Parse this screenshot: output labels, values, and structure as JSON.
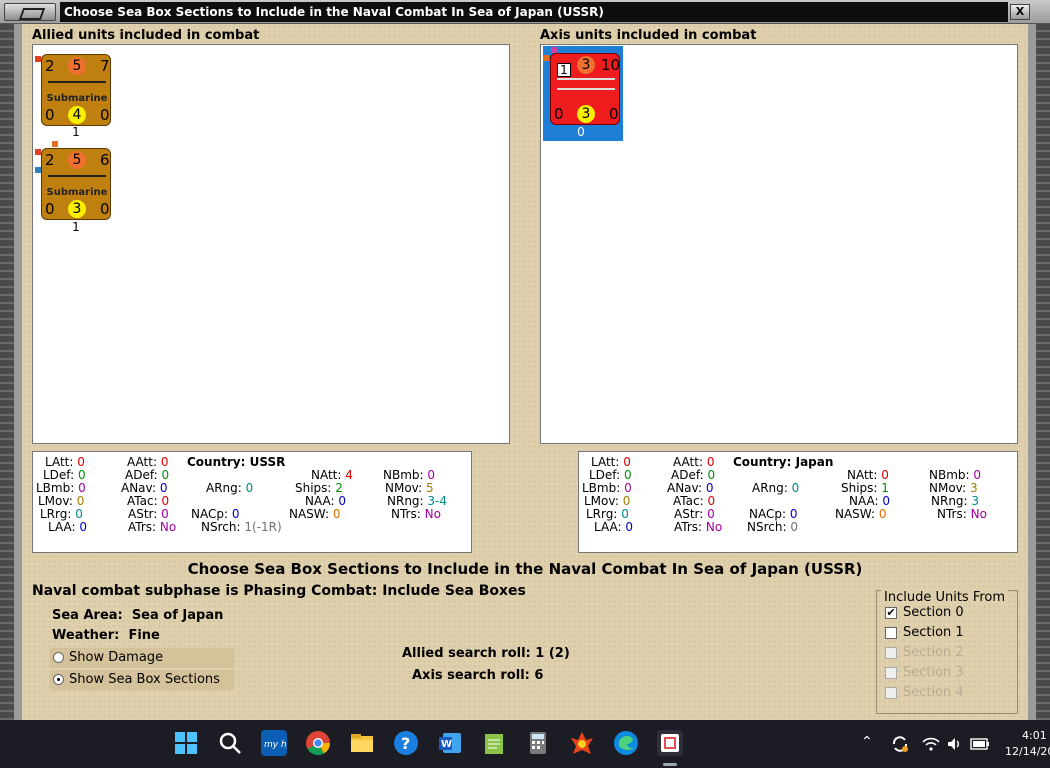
{
  "window": {
    "title": "Choose Sea Box Sections to Include in the Naval Combat In Sea of Japan (USSR)",
    "close_label": "X"
  },
  "allied": {
    "label": "Allied units included in combat",
    "units": [
      {
        "top_left": "2",
        "top_mid": "5",
        "top_right": "7",
        "type": "Submarine",
        "bot_left": "0",
        "bot_mid": "4",
        "bot_right": "0",
        "count": "1"
      },
      {
        "top_left": "2",
        "top_mid": "5",
        "top_right": "6",
        "type": "Submarine",
        "bot_left": "0",
        "bot_mid": "3",
        "bot_right": "0",
        "count": "1"
      }
    ]
  },
  "axis": {
    "label": "Axis units included in combat",
    "units": [
      {
        "badge": "1",
        "top_mid": "3",
        "top_right": "10",
        "bot_left": "0",
        "bot_mid": "3",
        "bot_right": "0",
        "count": "0"
      }
    ]
  },
  "allied_stats": {
    "country_label": "Country:",
    "country": "USSR",
    "LAtt": "0",
    "AAtt": "0",
    "LDef": "0",
    "ADef": "0",
    "NAtt": "4",
    "NBmb": "0",
    "LBmb": "0",
    "ANav": "0",
    "ARng": "0",
    "Ships": "2",
    "NMov": "5",
    "LMov": "0",
    "ATac": "0",
    "NAA": "0",
    "NRng": "3-4",
    "LRrg": "0",
    "AStr": "0",
    "NACp": "0",
    "NASW": "0",
    "NTrs": "No",
    "LAA": "0",
    "ATrs": "No",
    "NSrch": "1(-1R)"
  },
  "axis_stats": {
    "country_label": "Country:",
    "country": "Japan",
    "LAtt": "0",
    "AAtt": "0",
    "LDef": "0",
    "ADef": "0",
    "NAtt": "0",
    "NBmb": "0",
    "LBmb": "0",
    "ANav": "0",
    "ARng": "0",
    "Ships": "1",
    "NMov": "3",
    "LMov": "0",
    "ATac": "0",
    "NAA": "0",
    "NRng": "3",
    "LRrg": "0",
    "AStr": "0",
    "NACp": "0",
    "NASW": "0",
    "NTrs": "No",
    "LAA": "0",
    "ATrs": "No",
    "NSrch": "0"
  },
  "heading": "Choose Sea Box Sections to Include in the Naval Combat In Sea of Japan (USSR)",
  "subphase": "Naval combat subphase is Phasing Combat: Include Sea Boxes",
  "info": {
    "sea_area_label": "Sea Area:",
    "sea_area": "Sea of Japan",
    "weather_label": "Weather:",
    "weather": "Fine"
  },
  "options": {
    "show_damage": "Show Damage",
    "show_sections": "Show Sea Box Sections",
    "selected": "show_sections"
  },
  "rolls": {
    "allied": "Allied search roll: 1 (2)",
    "axis": "Axis search roll: 6"
  },
  "include_units": {
    "title": "Include Units From",
    "sections": [
      {
        "label": "Section 0",
        "checked": true,
        "enabled": true
      },
      {
        "label": "Section 1",
        "checked": false,
        "enabled": true
      },
      {
        "label": "Section 2",
        "checked": false,
        "enabled": false
      },
      {
        "label": "Section 3",
        "checked": false,
        "enabled": false
      },
      {
        "label": "Section 4",
        "checked": false,
        "enabled": false
      }
    ]
  },
  "taskbar": {
    "icons": [
      "windows-start",
      "search",
      "myhp",
      "chrome",
      "file-explorer",
      "help",
      "word",
      "notepad",
      "calculator",
      "game",
      "edge",
      "snipping"
    ],
    "time": "4:01",
    "date": "12/14/20"
  },
  "colors": {
    "allied_counter": "#c08010",
    "axis_counter": "#ee1c1c",
    "selection": "#1f7fd6",
    "background": "#dfd0ad"
  }
}
